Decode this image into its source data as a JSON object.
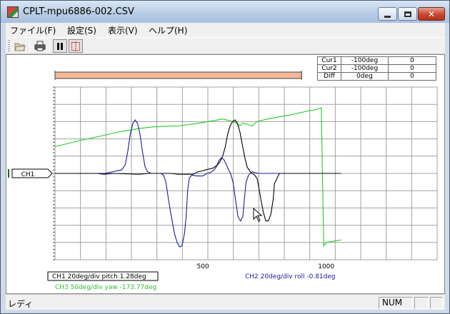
{
  "window": {
    "title": "CPLT-mpu6886-002.CSV",
    "close_glyph": "✕"
  },
  "menu": {
    "items": [
      "ファイル(F)",
      "設定(S)",
      "表示(V)",
      "ヘルプ(H)"
    ]
  },
  "toolbar": {
    "buttons": [
      "open-folder-icon",
      "print-icon",
      "pause-icon",
      "cursor-select-icon"
    ],
    "pause_pressed": true,
    "cursor_pressed": true
  },
  "cursor_table": {
    "rows": [
      {
        "label": "Cur1",
        "time": "-100deg",
        "value": "0"
      },
      {
        "label": "Cur2",
        "time": "-100deg",
        "value": "0"
      },
      {
        "label": "Diff",
        "time": "0deg",
        "value": "0"
      }
    ]
  },
  "plot": {
    "channel_marker": "CH1",
    "x_ticks": [
      {
        "value": 500,
        "label": "500"
      },
      {
        "value": 1000,
        "label": "1000"
      }
    ],
    "legend": {
      "ch1": "CH1 20deg/div pitch 1.28deg",
      "ch2": "CH2 20deg/div roll -0.81deg",
      "ch3": "CH3 50deg/div yaw -173.77deg"
    },
    "colors": {
      "ch1": "#000000",
      "ch2": "#1a1aa0",
      "ch3": "#22cc22",
      "grid": "#a0a0a0",
      "range_bar": "#f4b898"
    }
  },
  "chart_data": {
    "type": "line",
    "title": "",
    "xlabel": "",
    "ylabel": "",
    "xlim": [
      -100,
      1450
    ],
    "ylim": [
      -100,
      100
    ],
    "x_ticks": [
      500,
      1000
    ],
    "grid": true,
    "range_bar": [
      -100,
      900
    ],
    "series": [
      {
        "name": "CH1 pitch",
        "color": "#000000",
        "scale": "20deg/div",
        "points": [
          [
            -100,
            0
          ],
          [
            70,
            0
          ],
          [
            100,
            -1
          ],
          [
            140,
            0
          ],
          [
            240,
            -1
          ],
          [
            280,
            0
          ],
          [
            370,
            0
          ],
          [
            400,
            -1
          ],
          [
            460,
            -1
          ],
          [
            480,
            2
          ],
          [
            500,
            3
          ],
          [
            510,
            4
          ],
          [
            525,
            5
          ],
          [
            540,
            6
          ],
          [
            560,
            10
          ],
          [
            570,
            14
          ],
          [
            580,
            20
          ],
          [
            590,
            30
          ],
          [
            600,
            45
          ],
          [
            610,
            55
          ],
          [
            620,
            60
          ],
          [
            630,
            62
          ],
          [
            640,
            58
          ],
          [
            650,
            48
          ],
          [
            660,
            33
          ],
          [
            670,
            18
          ],
          [
            680,
            7
          ],
          [
            695,
            1
          ],
          [
            710,
            -2
          ],
          [
            720,
            -6
          ],
          [
            725,
            -14
          ],
          [
            735,
            -30
          ],
          [
            745,
            -45
          ],
          [
            755,
            -55
          ],
          [
            765,
            -55
          ],
          [
            775,
            -48
          ],
          [
            785,
            -30
          ],
          [
            790,
            -12
          ],
          [
            800,
            -6
          ],
          [
            810,
            0
          ],
          [
            820,
            0
          ],
          [
            850,
            0
          ],
          [
            950,
            0
          ],
          [
            1000,
            0
          ],
          [
            1060,
            0
          ]
        ]
      },
      {
        "name": "CH2 roll",
        "color": "#1a1aa0",
        "scale": "20deg/div",
        "points": [
          [
            -100,
            0
          ],
          [
            60,
            0
          ],
          [
            100,
            0
          ],
          [
            120,
            1
          ],
          [
            150,
            3
          ],
          [
            170,
            4
          ],
          [
            185,
            10
          ],
          [
            195,
            25
          ],
          [
            205,
            45
          ],
          [
            215,
            57
          ],
          [
            225,
            62
          ],
          [
            235,
            58
          ],
          [
            245,
            45
          ],
          [
            255,
            25
          ],
          [
            265,
            8
          ],
          [
            275,
            2
          ],
          [
            290,
            0
          ],
          [
            330,
            0
          ],
          [
            340,
            -2
          ],
          [
            350,
            -10
          ],
          [
            360,
            -30
          ],
          [
            372,
            -50
          ],
          [
            385,
            -70
          ],
          [
            395,
            -80
          ],
          [
            405,
            -85
          ],
          [
            415,
            -84
          ],
          [
            425,
            -70
          ],
          [
            432,
            -50
          ],
          [
            438,
            -20
          ],
          [
            445,
            -5
          ],
          [
            455,
            -2
          ],
          [
            475,
            -3
          ],
          [
            500,
            -3
          ],
          [
            515,
            0
          ],
          [
            530,
            1
          ],
          [
            545,
            4
          ],
          [
            555,
            8
          ],
          [
            565,
            15
          ],
          [
            575,
            18
          ],
          [
            585,
            16
          ],
          [
            595,
            10
          ],
          [
            605,
            4
          ],
          [
            612,
            0
          ],
          [
            622,
            -10
          ],
          [
            632,
            -30
          ],
          [
            642,
            -50
          ],
          [
            652,
            -55
          ],
          [
            662,
            -50
          ],
          [
            668,
            -30
          ],
          [
            675,
            -10
          ],
          [
            685,
            -2
          ],
          [
            700,
            2
          ],
          [
            710,
            1
          ],
          [
            725,
            0
          ],
          [
            800,
            0
          ],
          [
            1000,
            0
          ],
          [
            1060,
            0
          ]
        ]
      },
      {
        "name": "CH3 yaw",
        "color": "#22cc22",
        "scale": "50deg/div",
        "points": [
          [
            -100,
            31
          ],
          [
            0,
            38
          ],
          [
            80,
            43
          ],
          [
            160,
            48
          ],
          [
            240,
            52
          ],
          [
            300,
            54
          ],
          [
            400,
            55
          ],
          [
            480,
            58
          ],
          [
            540,
            61
          ],
          [
            580,
            63
          ],
          [
            610,
            61
          ],
          [
            640,
            58
          ],
          [
            650,
            55
          ],
          [
            660,
            58
          ],
          [
            680,
            57
          ],
          [
            700,
            55
          ],
          [
            720,
            60
          ],
          [
            760,
            63
          ],
          [
            800,
            65
          ],
          [
            860,
            68
          ],
          [
            920,
            72
          ],
          [
            960,
            74
          ],
          [
            980,
            76
          ],
          [
            990,
            -84
          ],
          [
            1000,
            -80
          ],
          [
            1060,
            -77
          ]
        ]
      }
    ]
  },
  "status": {
    "text": "レディ",
    "num": "NUM"
  }
}
